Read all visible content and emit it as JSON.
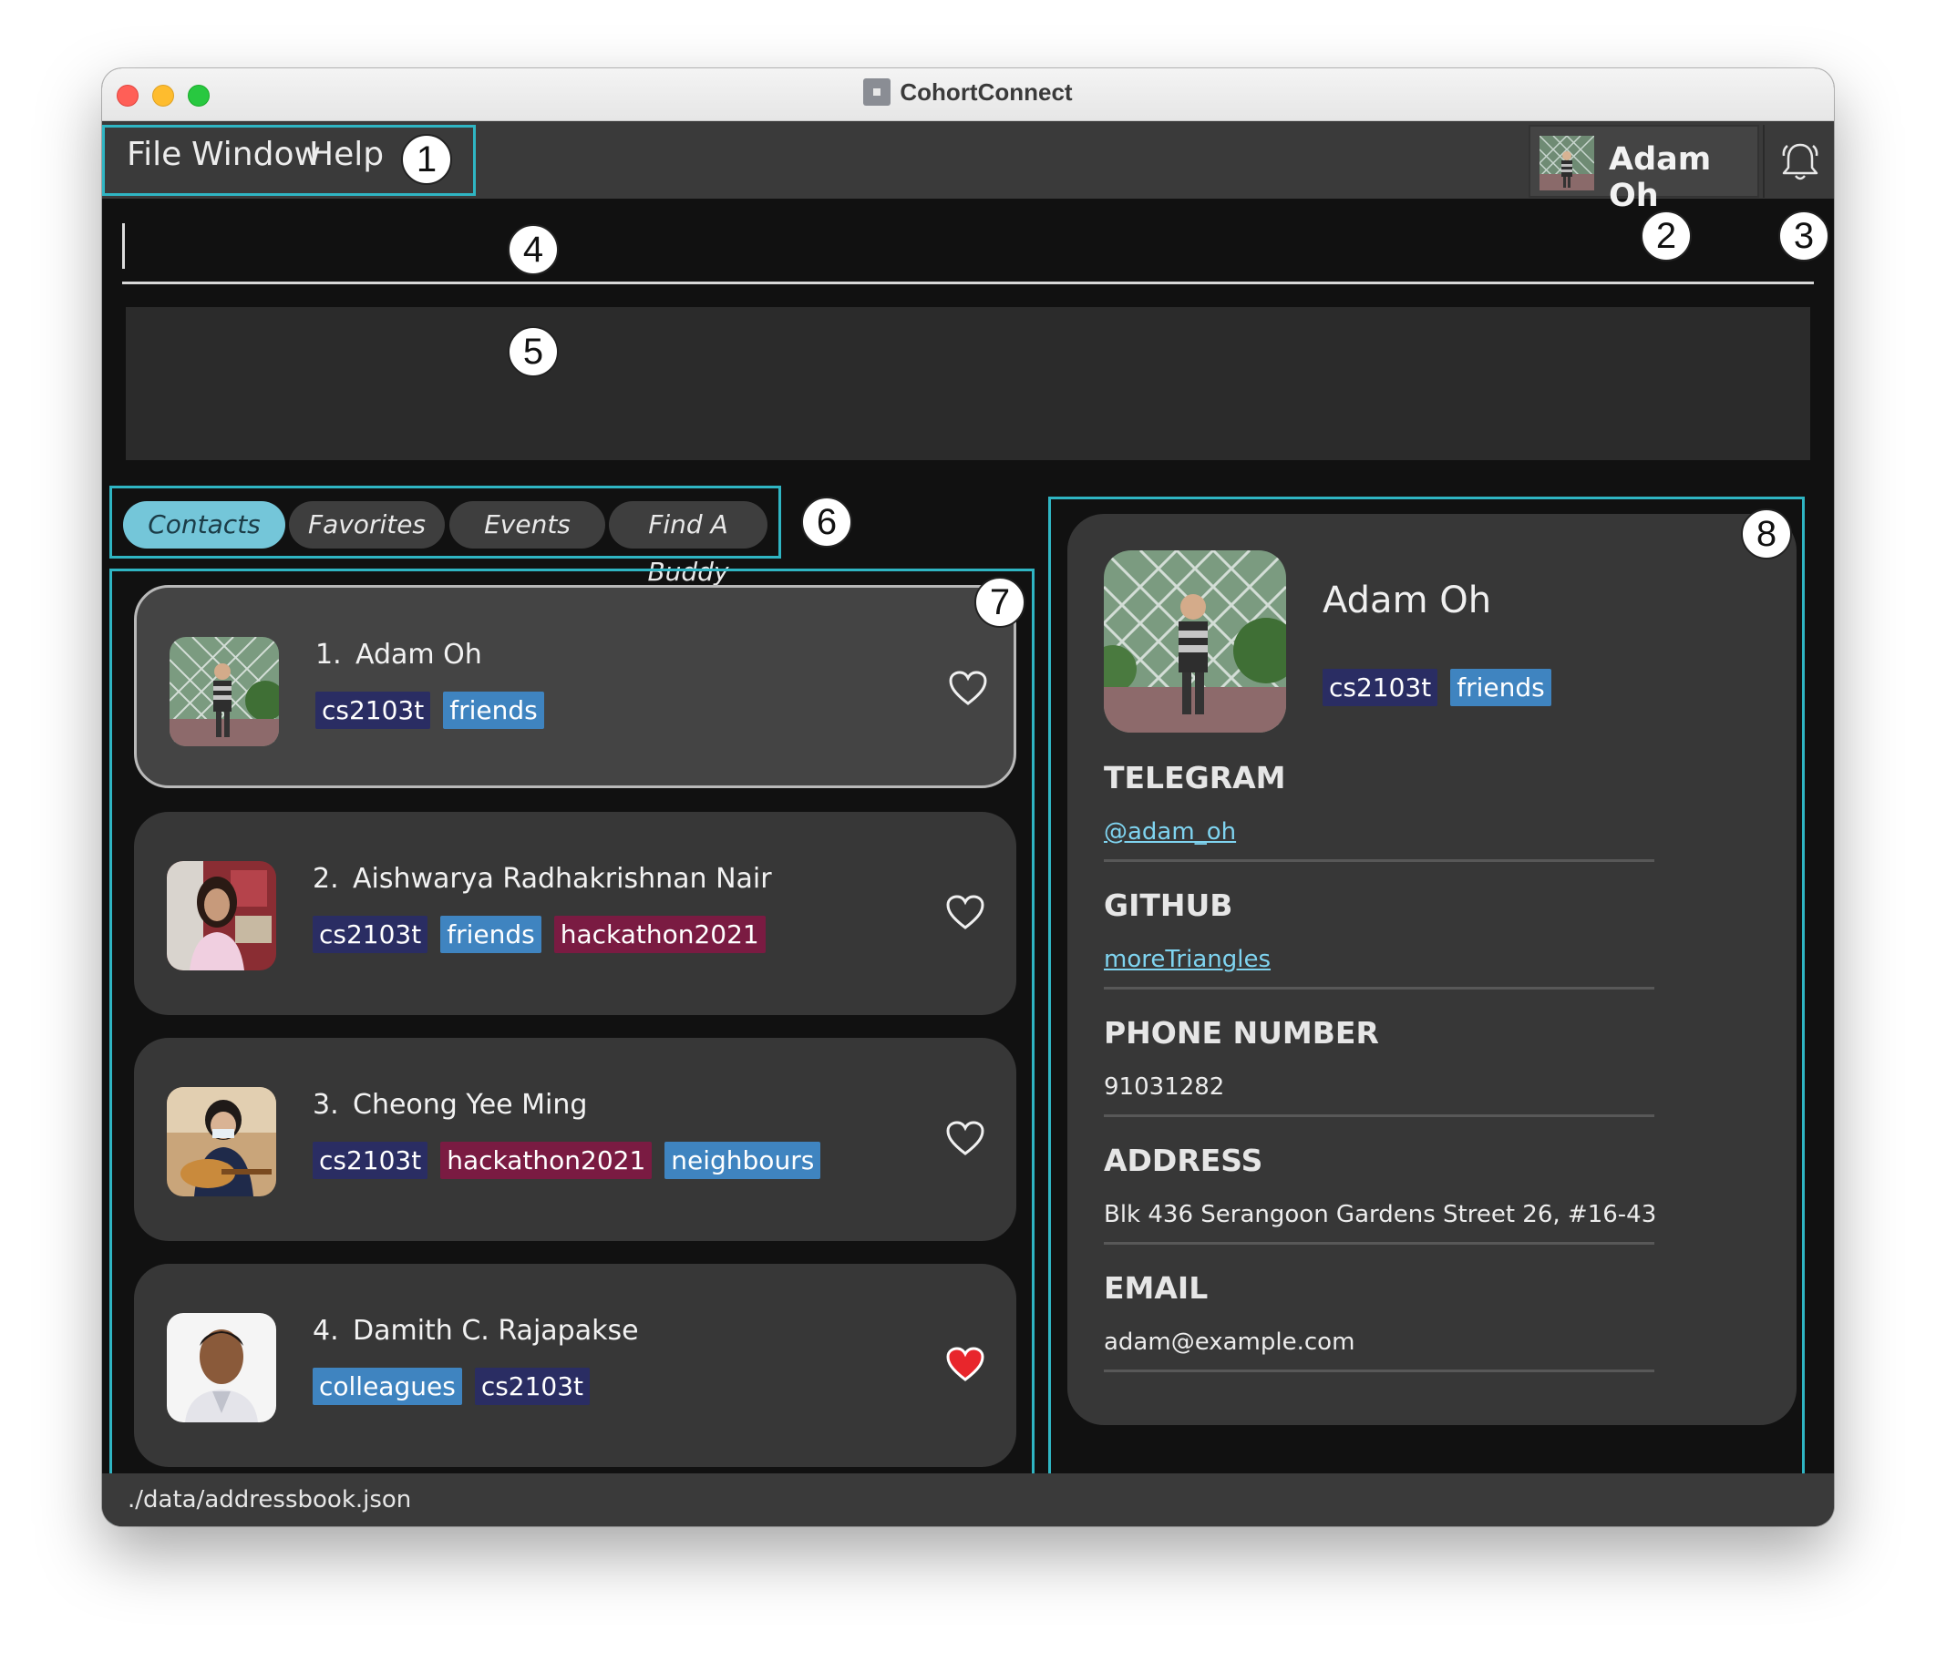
{
  "window": {
    "title": "CohortConnect"
  },
  "menu": {
    "items": [
      "File",
      "Window",
      "Help"
    ]
  },
  "user": {
    "name": "Adam Oh"
  },
  "annotations": [
    "1",
    "2",
    "3",
    "4",
    "5",
    "6",
    "7",
    "8"
  ],
  "command": {
    "value": ""
  },
  "tabs": [
    {
      "label": "Contacts",
      "active": true
    },
    {
      "label": "Favorites",
      "active": false
    },
    {
      "label": "Events",
      "active": false
    },
    {
      "label": "Find A Buddy",
      "active": false
    }
  ],
  "contacts": [
    {
      "index": "1.",
      "name": "Adam Oh",
      "tags": [
        "cs2103t",
        "friends"
      ],
      "favorite": false,
      "selected": true
    },
    {
      "index": "2.",
      "name": "Aishwarya Radhakrishnan Nair",
      "tags": [
        "cs2103t",
        "friends",
        "hackathon2021"
      ],
      "favorite": false,
      "selected": false
    },
    {
      "index": "3.",
      "name": "Cheong Yee Ming",
      "tags": [
        "cs2103t",
        "hackathon2021",
        "neighbours"
      ],
      "favorite": false,
      "selected": false
    },
    {
      "index": "4.",
      "name": "Damith C. Rajapakse",
      "tags": [
        "colleagues",
        "cs2103t"
      ],
      "favorite": true,
      "selected": false
    }
  ],
  "detail": {
    "name": "Adam Oh",
    "tags": [
      "cs2103t",
      "friends"
    ],
    "fields": [
      {
        "label": "TELEGRAM",
        "value": "@adam_oh",
        "link": true
      },
      {
        "label": "GITHUB",
        "value": "moreTriangles",
        "link": true
      },
      {
        "label": "PHONE NUMBER",
        "value": "91031282",
        "link": false
      },
      {
        "label": "ADDRESS",
        "value": "Blk 436 Serangoon Gardens Street 26, #16-43",
        "link": false
      },
      {
        "label": "EMAIL",
        "value": "adam@example.com",
        "link": false
      }
    ]
  },
  "status": {
    "path": "./data/addressbook.json"
  },
  "colors": {
    "accent_border": "#2fb5c3",
    "tab_active": "#74c6d9",
    "tag_cs2103t": "#2a2d63",
    "tag_friends": "#3f84c0",
    "tag_hackathon2021": "#7a1b42",
    "heart_favorite": "#e8262c"
  }
}
